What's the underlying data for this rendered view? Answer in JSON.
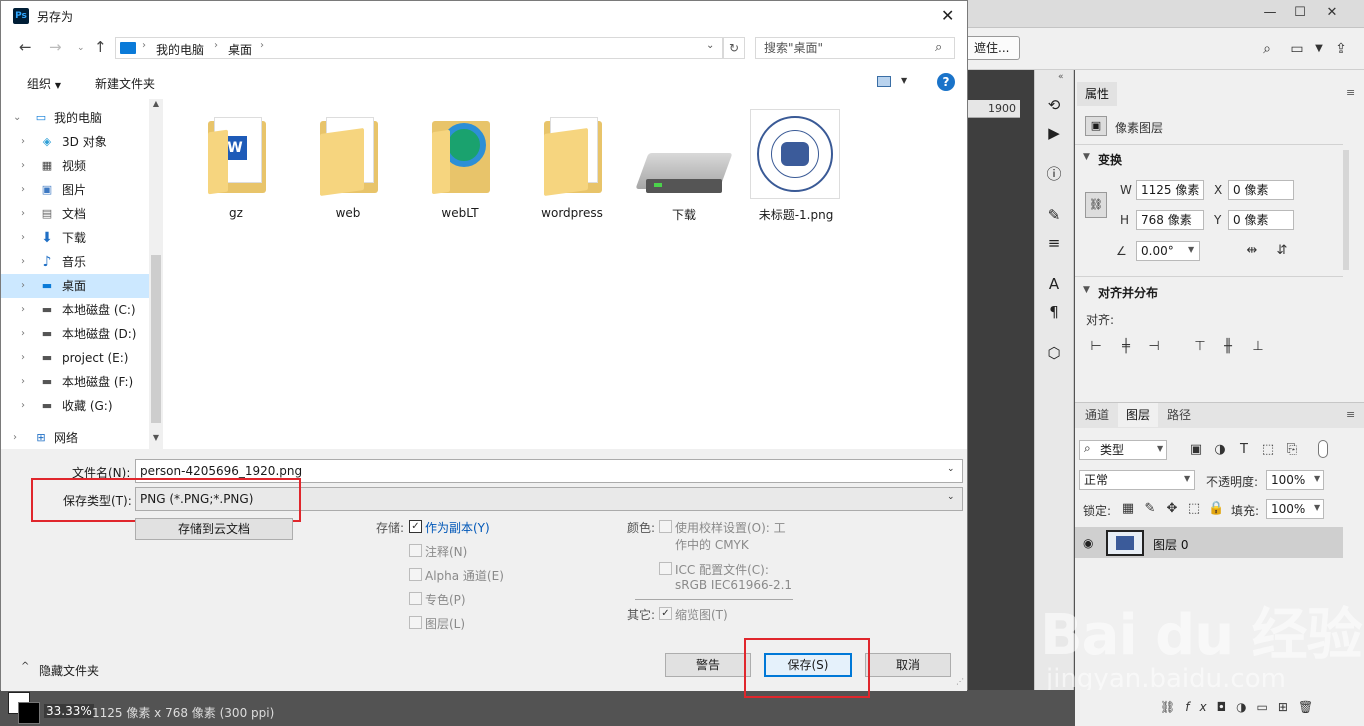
{
  "dialog": {
    "title": "另存为",
    "app_icon_text": "Ps",
    "close_glyph": "✕",
    "address": {
      "root": "我的电脑",
      "current": "桌面"
    },
    "search_placeholder": "搜索\"桌面\"",
    "toolbar": {
      "organize": "组织",
      "new_folder": "新建文件夹"
    },
    "tree": [
      {
        "label": "我的电脑",
        "icon": "computer-icon",
        "expanded": true
      },
      {
        "label": "3D 对象",
        "icon": "3d-objects-icon"
      },
      {
        "label": "视频",
        "icon": "video-icon"
      },
      {
        "label": "图片",
        "icon": "pictures-icon"
      },
      {
        "label": "文档",
        "icon": "documents-icon"
      },
      {
        "label": "下载",
        "icon": "download-icon"
      },
      {
        "label": "音乐",
        "icon": "music-icon"
      },
      {
        "label": "桌面",
        "icon": "desktop-icon",
        "selected": true
      },
      {
        "label": "本地磁盘 (C:)",
        "icon": "drive-icon"
      },
      {
        "label": "本地磁盘 (D:)",
        "icon": "drive-icon"
      },
      {
        "label": "project (E:)",
        "icon": "drive-icon"
      },
      {
        "label": "本地磁盘 (F:)",
        "icon": "drive-icon"
      },
      {
        "label": "收藏 (G:)",
        "icon": "drive-icon"
      },
      {
        "label": "网络",
        "icon": "network-icon"
      }
    ],
    "files": [
      {
        "name": "gz",
        "type": "folder-word"
      },
      {
        "name": "web",
        "type": "folder"
      },
      {
        "name": "webLT",
        "type": "folder-edge"
      },
      {
        "name": "wordpress",
        "type": "folder"
      },
      {
        "name": "下载",
        "type": "drive"
      },
      {
        "name": "未标题-1.png",
        "type": "image"
      }
    ],
    "filename_label": "文件名(N):",
    "filename_value": "person-4205696_1920.png",
    "filetype_label": "保存类型(T):",
    "filetype_value": "PNG (*.PNG;*.PNG)",
    "cloud_button": "存储到云文档",
    "save_section": {
      "label": "存储:",
      "options": [
        {
          "label": "作为副本(Y)",
          "checked": true,
          "enabled": true
        },
        {
          "label": "注释(N)",
          "checked": false,
          "enabled": false
        },
        {
          "label": "Alpha 通道(E)",
          "checked": false,
          "enabled": false
        },
        {
          "label": "专色(P)",
          "checked": false,
          "enabled": false
        },
        {
          "label": "图层(L)",
          "checked": false,
          "enabled": false
        }
      ]
    },
    "color_section": {
      "label": "颜色:",
      "proof_line1": "使用校样设置(O): 工",
      "proof_line2": "作中的 CMYK",
      "icc_line1": "ICC 配置文件(C):",
      "icc_line2": "sRGB IEC61966-2.1"
    },
    "other_section": {
      "label": "其它:",
      "thumbnail": "缩览图(T)"
    },
    "hide_folders": "隐藏文件夹",
    "buttons": {
      "warning": "警告",
      "save": "保存(S)",
      "cancel": "取消"
    }
  },
  "photoshop": {
    "mask_button": "遮住...",
    "ruler_value": "1900",
    "properties_tab": "属性",
    "pixel_layer": "像素图层",
    "transform": {
      "title": "变换",
      "w_label": "W",
      "w_value": "1125 像素",
      "h_label": "H",
      "h_value": "768 像素",
      "x_label": "X",
      "x_value": "0 像素",
      "y_label": "Y",
      "y_value": "0 像素",
      "angle_value": "0.00°"
    },
    "align": {
      "title": "对齐并分布",
      "sub": "对齐:"
    },
    "layer_tabs": [
      "通道",
      "图层",
      "路径"
    ],
    "kind_filter": "类型",
    "blend_mode": "正常",
    "opacity_label": "不透明度:",
    "opacity_value": "100%",
    "lock_label": "锁定:",
    "fill_label": "填充:",
    "fill_value": "100%",
    "layer_name": "图层 0",
    "zoom": "33.33%",
    "doc_info": "1125 像素 x 768 像素 (300 ppi)",
    "watermark": "Bai du 经验",
    "watermark_url": "jingyan.baidu.com"
  },
  "colors": {
    "accent": "#0078d7",
    "highlight_red": "#e0262c",
    "tree_selected": "#cce8ff"
  }
}
